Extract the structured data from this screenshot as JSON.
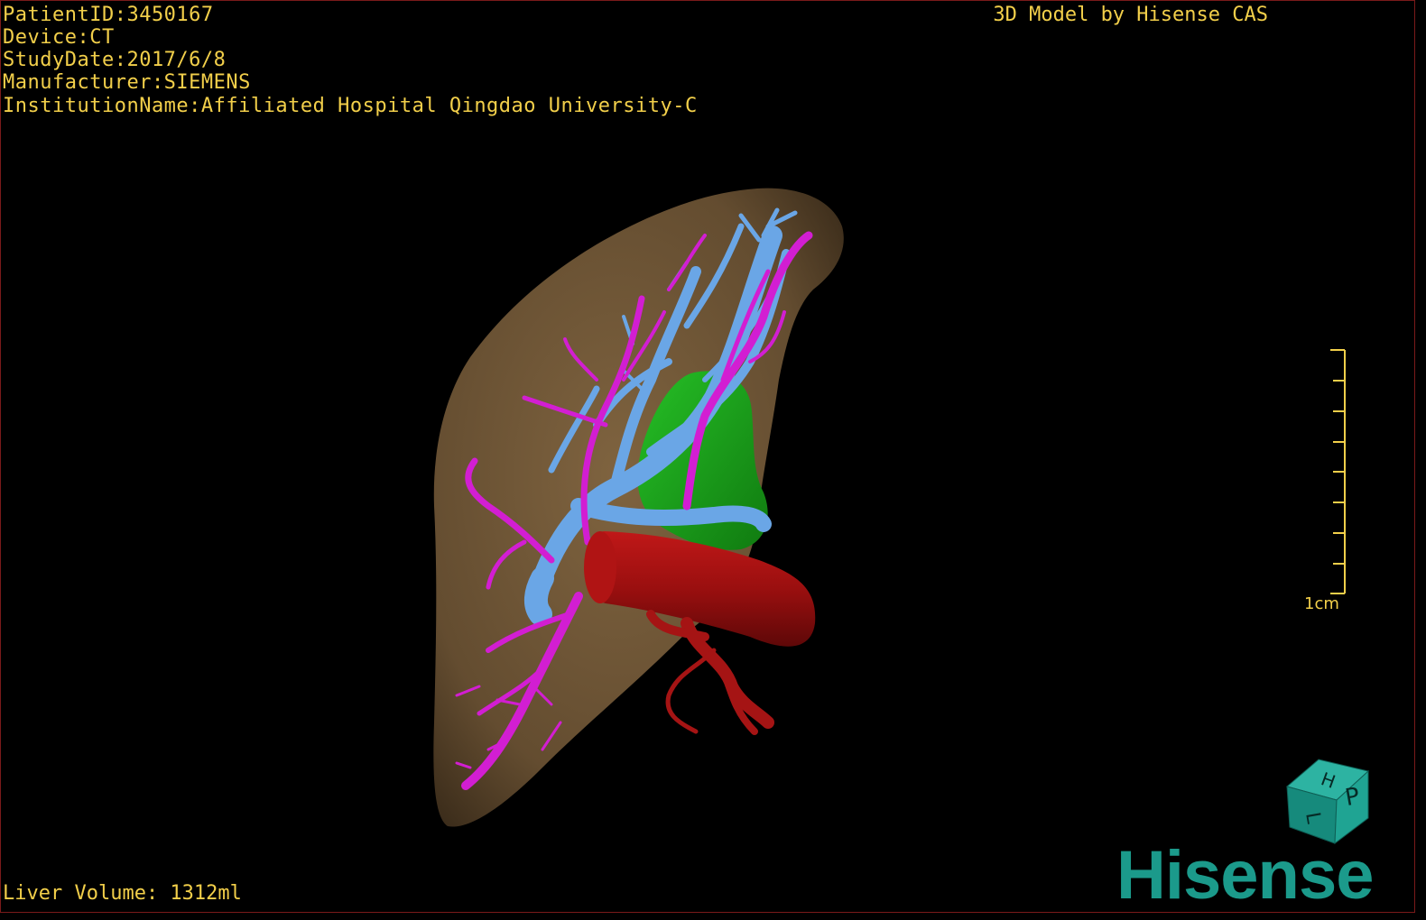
{
  "dicom_info": {
    "patient_id": "PatientID:3450167",
    "device": "Device:CT",
    "study_date": "StudyDate:2017/6/8",
    "manufacturer": "Manufacturer:SIEMENS",
    "institution": "InstitutionName:Affiliated Hospital Qingdao University-C"
  },
  "credit": "3D Model by Hisense CAS",
  "liver_volume": "Liver Volume: 1312ml",
  "scale_bar": {
    "label": "1cm"
  },
  "orientation_cube": {
    "face_top": "H",
    "face_front": "P",
    "face_side": "L"
  },
  "logo_text": "Hisense",
  "colors": {
    "text": "#f2cf4a",
    "liver": "#7a5f3c",
    "hepatic_vein": "#6aa6e6",
    "portal_vein": "#d21ed2",
    "inferior_vena_cava": "#9c1010",
    "gallbladder": "#1eaa1e",
    "logo": "#1b9a8b"
  }
}
